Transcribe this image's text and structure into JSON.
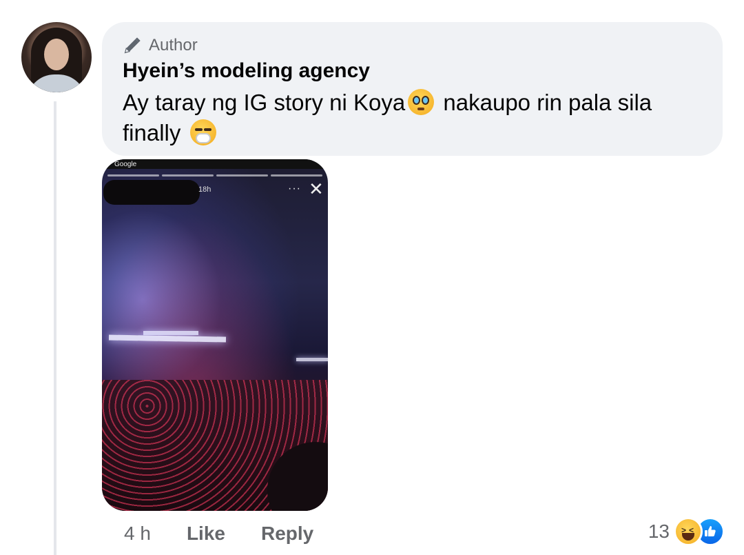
{
  "comment": {
    "badge_label": "Author",
    "author_name": "Hyein’s modeling agency",
    "text_part1": "Ay taray ng IG story ni Koya",
    "text_part2": " nakaupo rin pala sila finally ",
    "emoji_1": "pleading-face-icon",
    "emoji_2": "face-with-hand-over-mouth-icon"
  },
  "attachment": {
    "status_label": "Google",
    "story_time": "18h",
    "more_glyph": "···",
    "close_glyph": "✕"
  },
  "footer": {
    "time_ago": "4 h",
    "like_label": "Like",
    "reply_label": "Reply",
    "reaction_count": "13",
    "reactions": [
      "haha-reaction-icon",
      "like-reaction-icon"
    ]
  },
  "colors": {
    "bubble_bg": "#f0f2f5",
    "meta_text": "#65676b",
    "like_blue": "#0a66e8"
  }
}
